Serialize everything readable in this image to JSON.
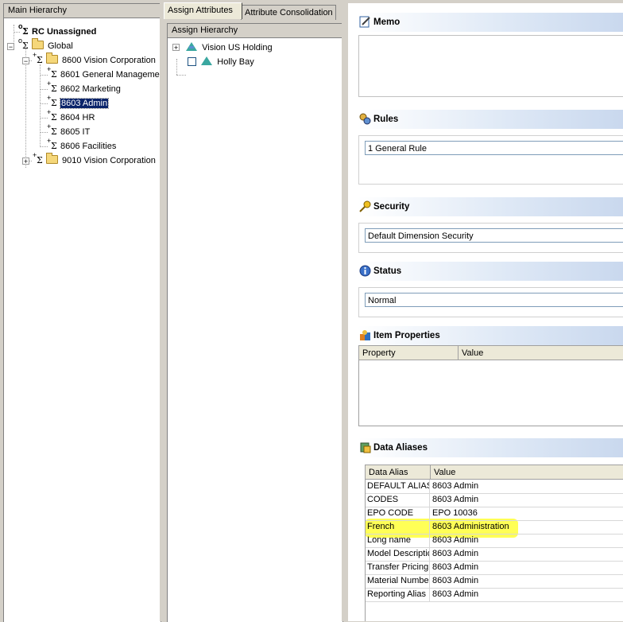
{
  "left_pane": {
    "header": "Main Hierarchy",
    "tree": [
      {
        "label": "RC Unassigned",
        "sup": "o",
        "bold": true
      },
      {
        "label": "Global",
        "sup": "o"
      },
      {
        "label": "8600 Vision Corporation",
        "sup": "+"
      },
      {
        "label": "8601 General Manageme",
        "sup": "+"
      },
      {
        "label": "8602 Marketing",
        "sup": "+"
      },
      {
        "label": "8603 Admin",
        "sup": "+",
        "selected": true
      },
      {
        "label": "8604 HR",
        "sup": "+"
      },
      {
        "label": "8605 IT",
        "sup": "+"
      },
      {
        "label": "8606 Facilities",
        "sup": "+"
      },
      {
        "label": "9010 Vision Corporation",
        "sup": "+"
      }
    ]
  },
  "middle_pane": {
    "tabs": [
      {
        "label": "Assign Attributes",
        "active": true
      },
      {
        "label": "Attribute Consolidation",
        "active": false
      }
    ],
    "header": "Assign Hierarchy",
    "tree": [
      {
        "label": "Vision US Holding"
      },
      {
        "label": "Holly Bay"
      }
    ]
  },
  "right_pane": {
    "memo": {
      "title": "Memo"
    },
    "rules": {
      "title": "Rules",
      "value": "1 General Rule"
    },
    "security": {
      "title": "Security",
      "value": "Default Dimension Security"
    },
    "status": {
      "title": "Status",
      "value": "Normal"
    },
    "item_properties": {
      "title": "Item Properties",
      "columns": [
        "Property",
        "Value"
      ]
    },
    "data_aliases": {
      "title": "Data Aliases",
      "columns": [
        "Data Alias",
        "Value"
      ],
      "rows": [
        {
          "alias": "DEFAULT ALIAS",
          "value": "8603 Admin"
        },
        {
          "alias": "CODES",
          "value": "8603 Admin"
        },
        {
          "alias": "EPO CODE",
          "value": "EPO 10036"
        },
        {
          "alias": "French",
          "value": "8603 Administration",
          "highlighted": true
        },
        {
          "alias": "Long name",
          "value": "8603 Admin"
        },
        {
          "alias": "Model Descriptio",
          "value": "8603 Admin"
        },
        {
          "alias": "Transfer Pricing",
          "value": "8603 Admin"
        },
        {
          "alias": "Material Number",
          "value": "8603 Admin"
        },
        {
          "alias": "Reporting Alias",
          "value": "8603 Admin"
        }
      ]
    }
  },
  "colors": {
    "selection": "#0a246a",
    "highlight": "#ffff38",
    "section_gradient": "#c9d8ee"
  }
}
